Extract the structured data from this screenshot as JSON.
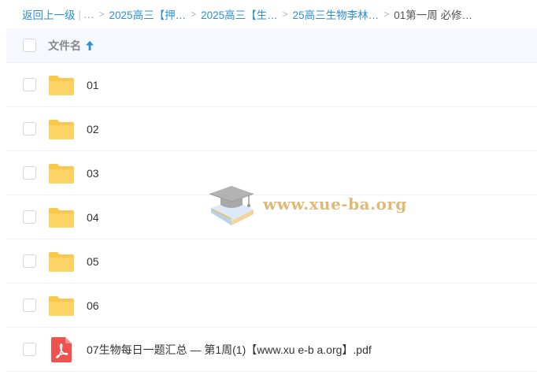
{
  "breadcrumb": {
    "back": "返回上一级",
    "ellipsis": "…",
    "items": [
      "2025高三【押…",
      "2025高三【生…",
      "25高三生物李林…"
    ],
    "current": "01第一周 必修…"
  },
  "header": {
    "column_label": "文件名",
    "sort_direction": "ascending"
  },
  "files": [
    {
      "name": "01",
      "type": "folder-icon"
    },
    {
      "name": "02",
      "type": "folder-icon"
    },
    {
      "name": "03",
      "type": "folder-icon"
    },
    {
      "name": "04",
      "type": "folder-icon"
    },
    {
      "name": "05",
      "type": "folder-icon"
    },
    {
      "name": "06",
      "type": "folder-icon"
    },
    {
      "name": "07生物每日一题汇总 — 第1周(1)【www.xu e-b a.org】.pdf",
      "type": "pdf-icon"
    }
  ],
  "watermark": {
    "text": "www.xue-ba.org"
  },
  "colors": {
    "link": "#2a8fd8",
    "folder": "#f9c94f",
    "pdf": "#f0524f",
    "header_bg": "#f5f8fc"
  }
}
